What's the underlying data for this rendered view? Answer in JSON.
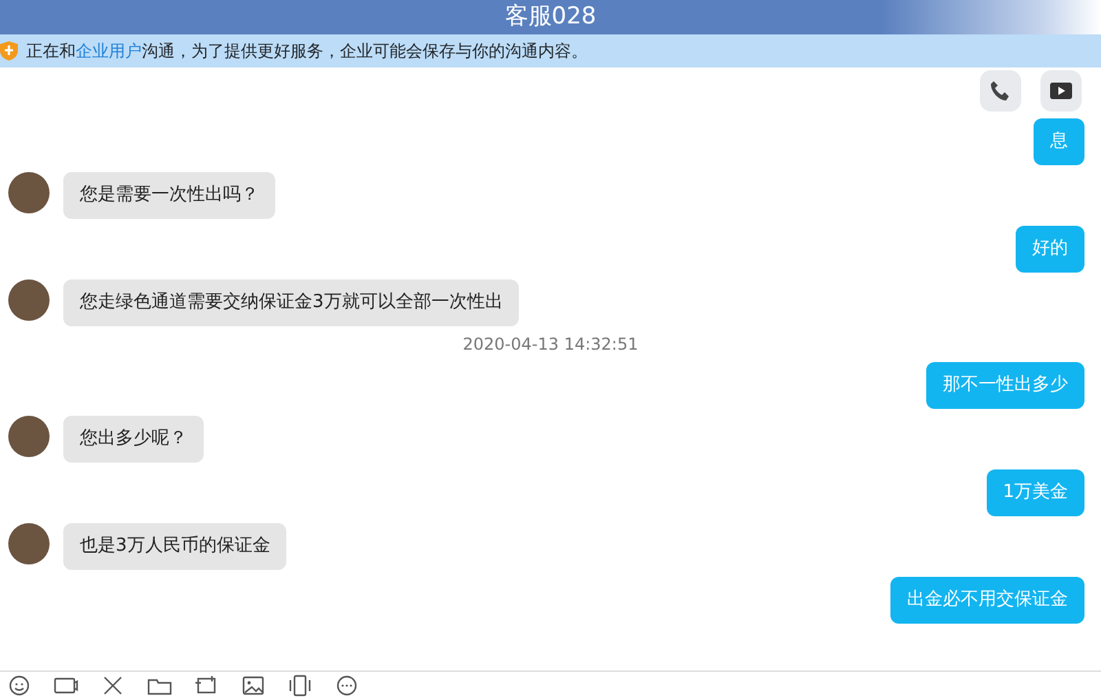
{
  "window": {
    "title": "客服028"
  },
  "notice": {
    "before": "正在和",
    "link": "企业用户",
    "after": "沟通，为了提供更好服务，企业可能会保存与你的沟通内容。"
  },
  "messages": [
    {
      "kind": "sent",
      "text": "息"
    },
    {
      "kind": "received",
      "text": "您是需要一次性出吗？"
    },
    {
      "kind": "sent",
      "text": "好的"
    },
    {
      "kind": "received",
      "text": "您走绿色通道需要交纳保证金3万就可以全部一次性出"
    },
    {
      "kind": "timestamp",
      "text": "2020-04-13 14:32:51"
    },
    {
      "kind": "sent",
      "text": "那不一性出多少"
    },
    {
      "kind": "received",
      "text": "您出多少呢？"
    },
    {
      "kind": "sent",
      "text": "1万美金"
    },
    {
      "kind": "received",
      "text": "也是3万人民币的保证金"
    },
    {
      "kind": "sent",
      "text": "出金必不用交保证金"
    }
  ]
}
